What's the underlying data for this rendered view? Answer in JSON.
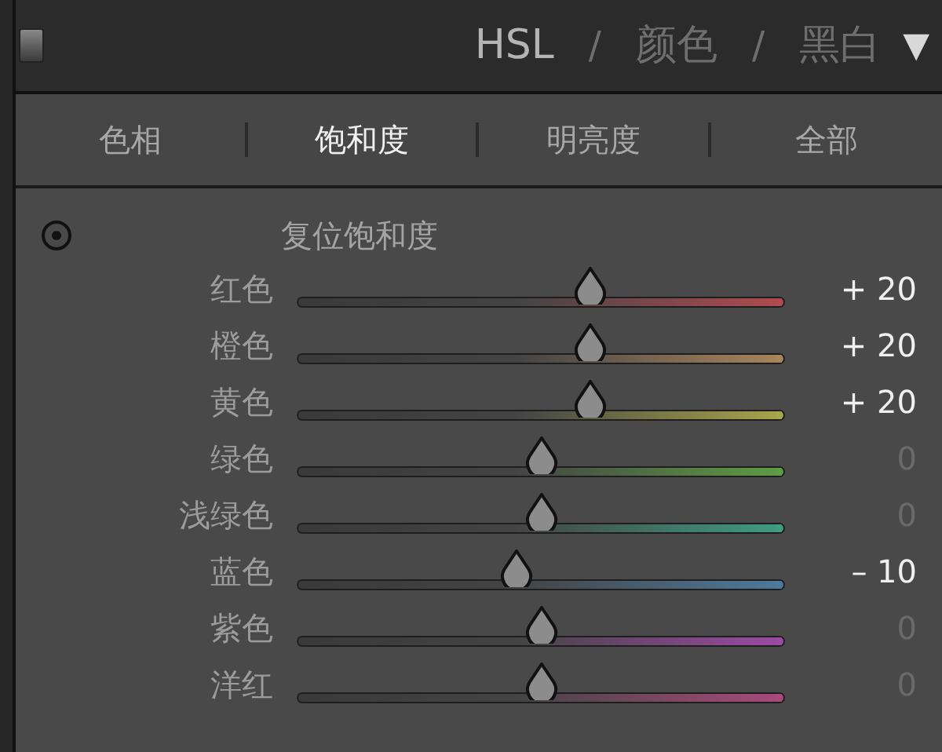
{
  "header": {
    "items": [
      {
        "kind": "mode",
        "label": "HSL",
        "selected": true
      },
      {
        "kind": "separator",
        "label": "/"
      },
      {
        "kind": "mode",
        "label": "颜色",
        "selected": false
      },
      {
        "kind": "separator",
        "label": "/"
      },
      {
        "kind": "mode",
        "label": "黑白",
        "selected": false
      }
    ],
    "menu_glyph": "▼"
  },
  "tabs": [
    {
      "label": "色相",
      "selected": false
    },
    {
      "label": "饱和度",
      "selected": true
    },
    {
      "label": "明亮度",
      "selected": false
    },
    {
      "label": "全部",
      "selected": false
    }
  ],
  "reset_label": "复位饱和度",
  "sliders": [
    {
      "name": "红色",
      "level": 0.6,
      "reading": "+ 20",
      "changed": true,
      "color": "#b04a50"
    },
    {
      "name": "橙色",
      "level": 0.6,
      "reading": "+ 20",
      "changed": true,
      "color": "#a8845c"
    },
    {
      "name": "黄色",
      "level": 0.6,
      "reading": "+ 20",
      "changed": true,
      "color": "#a8a64a"
    },
    {
      "name": "绿色",
      "level": 0.5,
      "reading": "0",
      "changed": false,
      "color": "#5e9c44"
    },
    {
      "name": "浅绿色",
      "level": 0.5,
      "reading": "0",
      "changed": false,
      "color": "#3e9c82"
    },
    {
      "name": "蓝色",
      "level": 0.45,
      "reading": "– 10",
      "changed": true,
      "color": "#4e7a9c"
    },
    {
      "name": "紫色",
      "level": 0.5,
      "reading": "0",
      "changed": false,
      "color": "#9c4aa4"
    },
    {
      "name": "洋红",
      "level": 0.5,
      "reading": "0",
      "changed": false,
      "color": "#a84a7a"
    }
  ]
}
